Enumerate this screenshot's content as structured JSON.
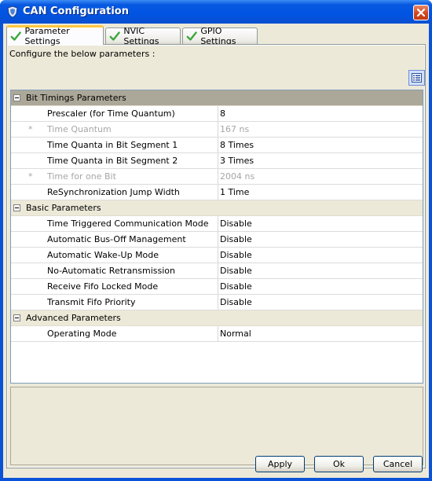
{
  "window": {
    "title": "CAN Configuration"
  },
  "tabs": [
    {
      "label": "Parameter Settings"
    },
    {
      "label": "NVIC Settings"
    },
    {
      "label": "GPIO Settings"
    }
  ],
  "instructions": "Configure the below parameters :",
  "groups": [
    {
      "label": "Bit Timings Parameters",
      "rows": [
        {
          "name": "Prescaler (for Time Quantum)",
          "value": "8"
        },
        {
          "name": "Time Quantum",
          "value": "167 ns",
          "marker": "*"
        },
        {
          "name": "Time Quanta in Bit Segment 1",
          "value": "8 Times"
        },
        {
          "name": "Time Quanta in Bit Segment 2",
          "value": "3 Times"
        },
        {
          "name": "Time for one Bit",
          "value": "2004 ns",
          "marker": "*"
        },
        {
          "name": "ReSynchronization Jump Width",
          "value": "1 Time"
        }
      ]
    },
    {
      "label": "Basic Parameters",
      "rows": [
        {
          "name": "Time Triggered Communication Mode",
          "value": "Disable"
        },
        {
          "name": "Automatic Bus-Off Management",
          "value": "Disable"
        },
        {
          "name": "Automatic Wake-Up Mode",
          "value": "Disable"
        },
        {
          "name": "No-Automatic Retransmission",
          "value": "Disable"
        },
        {
          "name": "Receive Fifo Locked Mode",
          "value": "Disable"
        },
        {
          "name": "Transmit Fifo Priority",
          "value": "Disable"
        }
      ]
    },
    {
      "label": "Advanced Parameters",
      "rows": [
        {
          "name": "Operating Mode",
          "value": "Normal"
        }
      ]
    }
  ],
  "buttons": {
    "apply": "Apply",
    "ok": "Ok",
    "cancel": "Cancel"
  },
  "icons": {
    "app": "app-shield-icon",
    "close": "close-icon",
    "tab_status": "check-icon",
    "view_toggle": "list-view-icon",
    "group_toggle": "collapse-minus-icon"
  },
  "colors": {
    "titlebar": "#0054e3",
    "window_bg": "#ece9d8",
    "active_tab_accent": "#ffc83c",
    "group_header_selected": "#aca899",
    "readonly_text": "#a6a6a6"
  }
}
